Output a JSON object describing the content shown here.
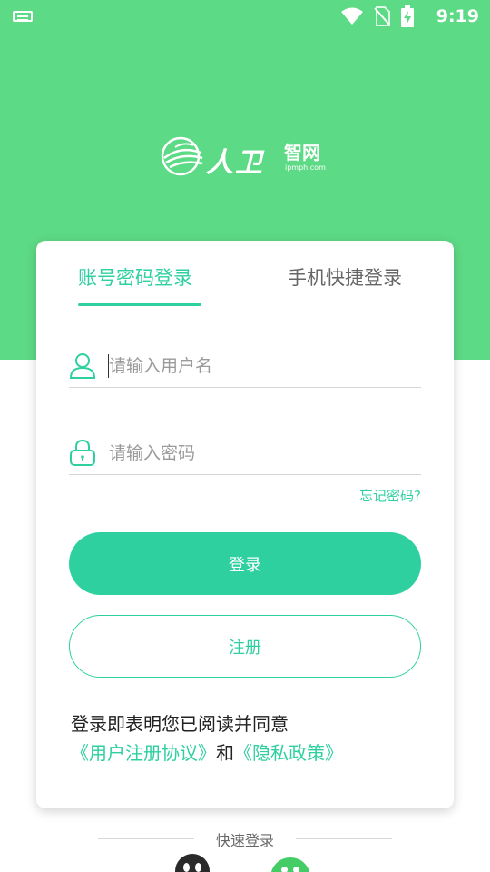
{
  "status_bar": {
    "time": "9:19"
  },
  "logo": {
    "main": "人卫",
    "sub": "智网",
    "url": "ipmph.com"
  },
  "tabs": {
    "account": "账号密码登录",
    "phone": "手机快捷登录"
  },
  "fields": {
    "username_placeholder": "请输入用户名",
    "password_placeholder": "请输入密码"
  },
  "forgot_password": "忘记密码?",
  "buttons": {
    "login": "登录",
    "register": "注册"
  },
  "agreement": {
    "prefix": "登录即表明您已阅读并同意",
    "user_agreement": "《用户注册协议》",
    "and": "和",
    "privacy_policy": "《隐私政策》"
  },
  "quick_login": {
    "label": "快速登录"
  },
  "colors": {
    "header_green": "#5dda85",
    "accent": "#2fd0a0"
  }
}
